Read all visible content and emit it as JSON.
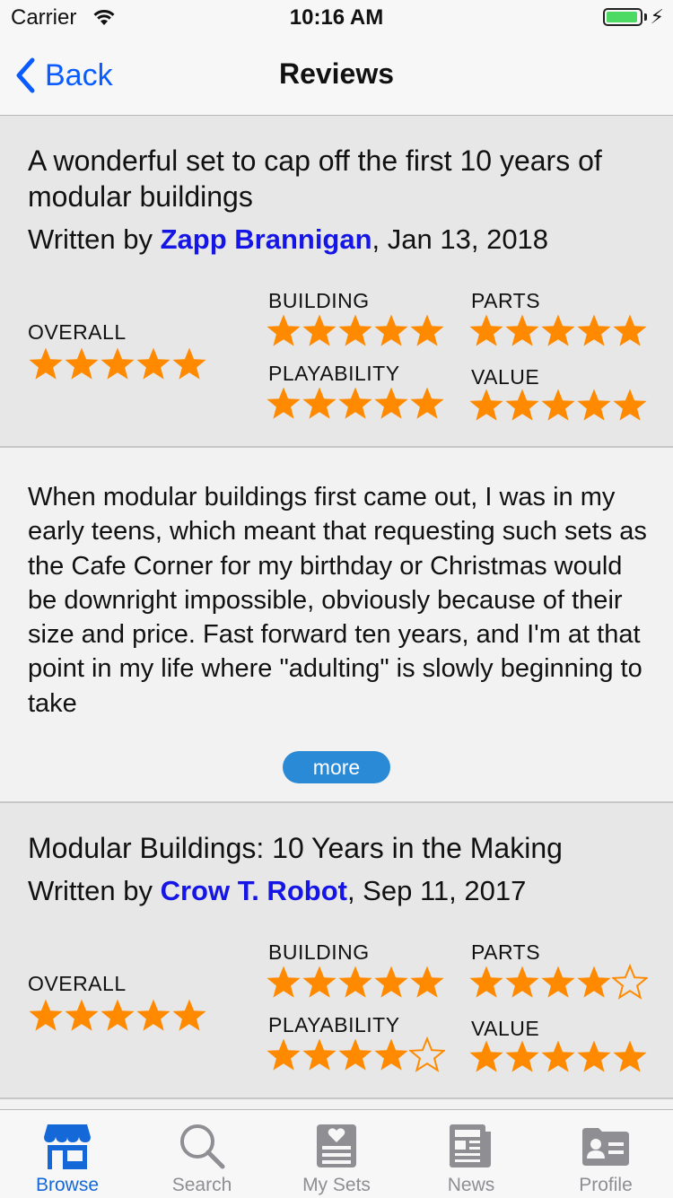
{
  "status_bar": {
    "carrier": "Carrier",
    "time": "10:16 AM"
  },
  "nav": {
    "back_label": "Back",
    "title": "Reviews"
  },
  "rating_labels": {
    "overall": "OVERALL",
    "building": "BUILDING",
    "parts": "PARTS",
    "playability": "PLAYABILITY",
    "value": "VALUE"
  },
  "reviews": [
    {
      "title": "A wonderful set to cap off the first 10 years of modular buildings",
      "written_by": "Written by ",
      "author": "Zapp Brannigan",
      "date": ", Jan 13, 2018",
      "ratings": {
        "overall": 5,
        "building": 5,
        "parts": 5,
        "playability": 5,
        "value": 5
      },
      "body": "When modular buildings first came out, I was in my early teens, which meant that requesting such sets as the Cafe Corner for my birthday or Christmas would be downright impossible, obviously because of their size and price. Fast forward ten years, and I'm at that point in my life where \"adulting\" is slowly beginning to take",
      "more_label": "more"
    },
    {
      "title": "Modular Buildings: 10 Years in the Making",
      "written_by": "Written by ",
      "author": "Crow T. Robot",
      "date": ", Sep 11, 2017",
      "ratings": {
        "overall": 5,
        "building": 5,
        "parts": 4,
        "playability": 4,
        "value": 5
      }
    }
  ],
  "tabs": [
    {
      "label": "Browse",
      "icon": "storefront-icon",
      "active": true
    },
    {
      "label": "Search",
      "icon": "magnifier-icon",
      "active": false
    },
    {
      "label": "My Sets",
      "icon": "heart-list-icon",
      "active": false
    },
    {
      "label": "News",
      "icon": "newspaper-icon",
      "active": false
    },
    {
      "label": "Profile",
      "icon": "id-card-icon",
      "active": false
    }
  ],
  "colors": {
    "accent": "#0a5cff",
    "star": "#ff8a00",
    "author": "#1515e6",
    "more_button": "#2a8ad6",
    "tab_active": "#1468d8",
    "tab_inactive": "#8e8e93"
  }
}
